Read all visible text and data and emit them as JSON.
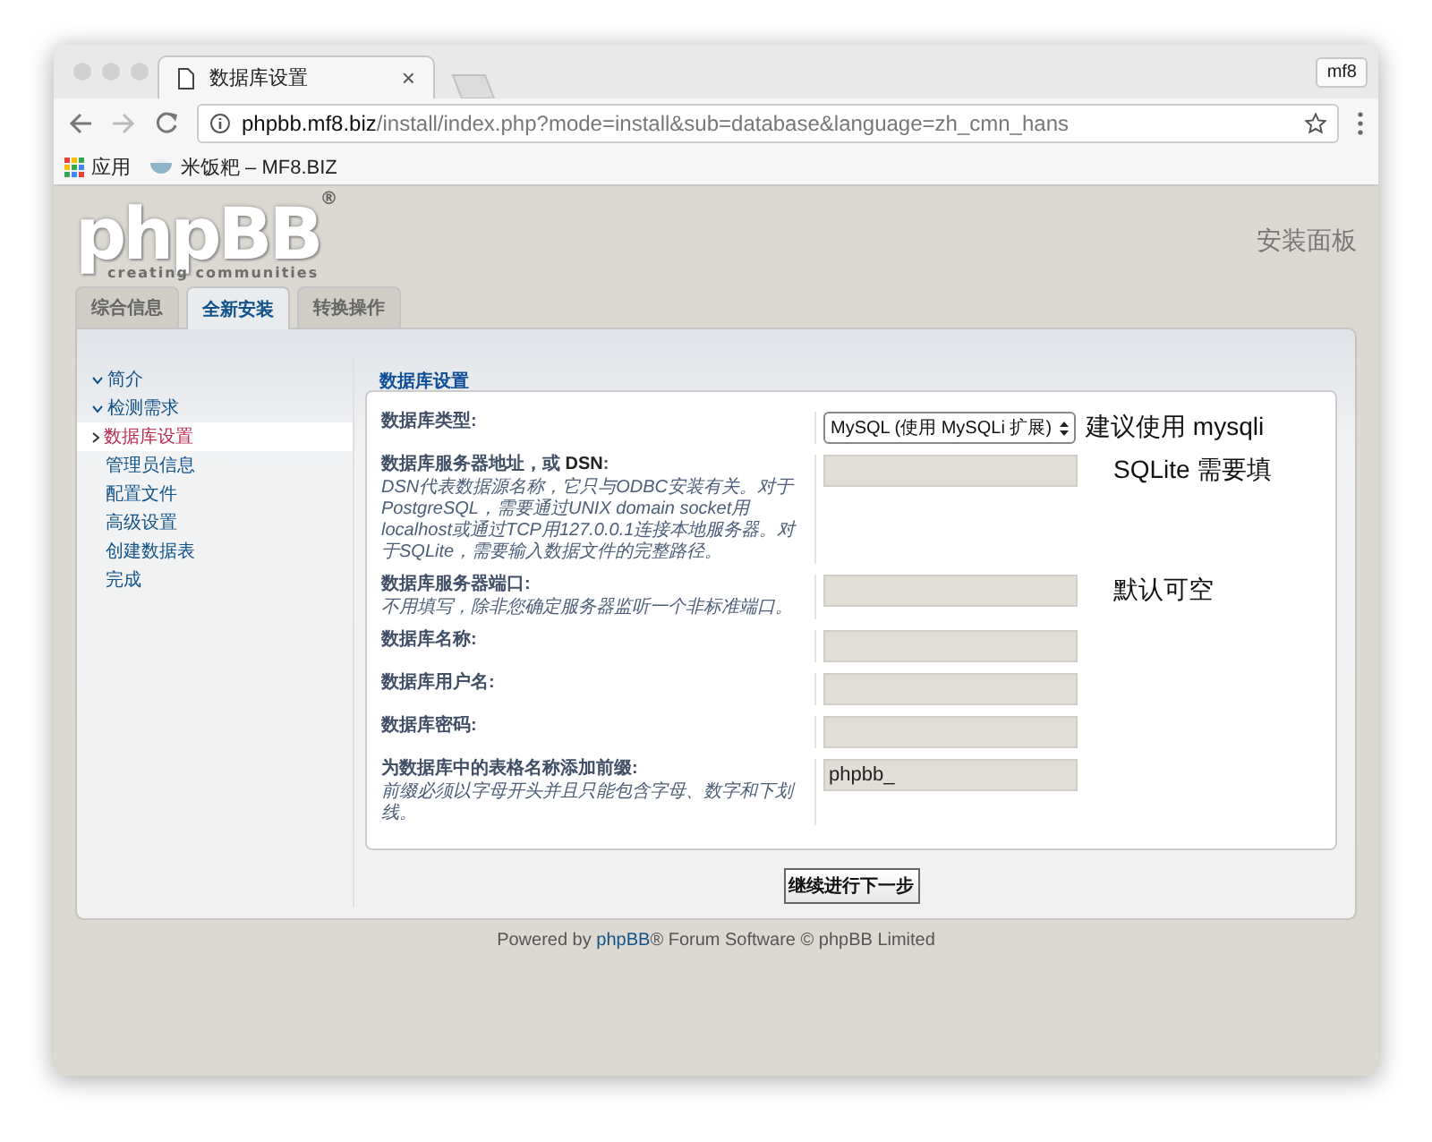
{
  "browser": {
    "tab_title": "数据库设置",
    "tab_close": "×",
    "profile": "mf8",
    "url_host": "phpbb.mf8.biz",
    "url_path": "/install/index.php?mode=install&sub=database&language=zh_cmn_hans",
    "bookmarks": [
      {
        "label": "应用",
        "kind": "apps"
      },
      {
        "label": "米饭粑 – MF8.BIZ",
        "kind": "site"
      }
    ]
  },
  "header": {
    "logo": "phpBB",
    "logo_mark": "®",
    "logo_tagline": "creating communities",
    "title": "安装面板"
  },
  "tabs": [
    {
      "label": "综合信息",
      "selected": false
    },
    {
      "label": "全新安装",
      "selected": true
    },
    {
      "label": "转换操作",
      "selected": false
    }
  ],
  "nav": [
    {
      "label": "简介",
      "completed": true,
      "selected": false
    },
    {
      "label": "检测需求",
      "completed": true,
      "selected": false
    },
    {
      "label": "数据库设置",
      "completed": false,
      "selected": true
    },
    {
      "label": "管理员信息",
      "completed": false,
      "selected": false
    },
    {
      "label": "配置文件",
      "completed": false,
      "selected": false
    },
    {
      "label": "高级设置",
      "completed": false,
      "selected": false
    },
    {
      "label": "创建数据表",
      "completed": false,
      "selected": false
    },
    {
      "label": "完成",
      "completed": false,
      "selected": false
    }
  ],
  "form": {
    "legend": "数据库设置",
    "fields": [
      {
        "label": "数据库类型:",
        "kind": "select",
        "value": "MySQL (使用 MySQLi 扩展)",
        "annotation": "建议使用 mysqli"
      },
      {
        "label": "数据库服务器地址，或 **DSN**:",
        "kind": "text",
        "description": "DSN代表数据源名称，它只与ODBC安装有关。对于PostgreSQL，需要通过UNIX domain socket用localhost或通过TCP用127.0.0.1连接本地服务器。对于SQLite，需要输入数据文件的完整路径。",
        "annotation": "SQLite 需要填"
      },
      {
        "label": "数据库服务器端口:",
        "kind": "text",
        "description": "不用填写，除非您确定服务器监听一个非标准端口。",
        "annotation": "默认可空"
      },
      {
        "label": "数据库名称:",
        "kind": "text"
      },
      {
        "label": "数据库用户名:",
        "kind": "text"
      },
      {
        "label": "数据库密码:",
        "kind": "password"
      },
      {
        "label": "为数据库中的表格名称添加前缀:",
        "kind": "text",
        "value": "phpbb_",
        "description": "前缀必须以字母开头并且只能包含字母、数字和下划线。"
      }
    ]
  },
  "submit": "继续进行下一步",
  "footer": {
    "before": "Powered by ",
    "link": "phpBB",
    "after": "® Forum Software © phpBB Limited"
  }
}
